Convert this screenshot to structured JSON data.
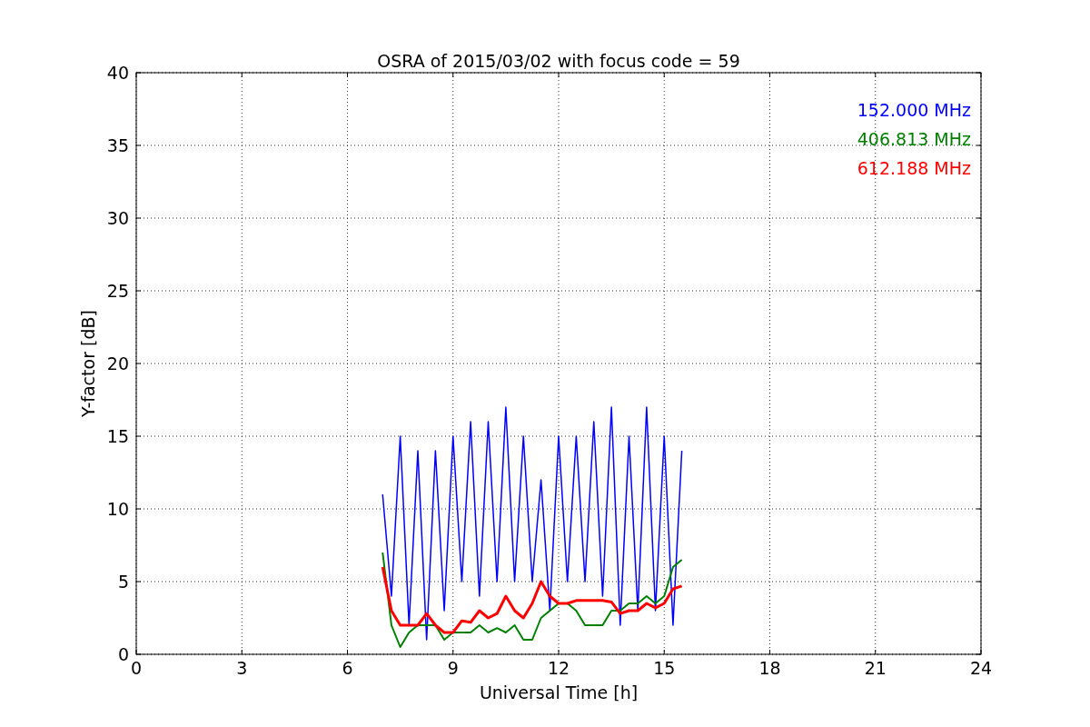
{
  "chart_data": {
    "type": "line",
    "title": "OSRA of 2015/03/02 with focus code = 59",
    "xlabel": "Universal Time [h]",
    "ylabel": "Y-factor [dB]",
    "x": [
      7.0,
      7.25,
      7.5,
      7.75,
      8.0,
      8.25,
      8.5,
      8.75,
      9.0,
      9.25,
      9.5,
      9.75,
      10.0,
      10.25,
      10.5,
      10.75,
      11.0,
      11.25,
      11.5,
      11.75,
      12.0,
      12.25,
      12.5,
      12.75,
      13.0,
      13.25,
      13.5,
      13.75,
      14.0,
      14.25,
      14.5,
      14.75,
      15.0,
      15.25,
      15.5
    ],
    "series": [
      {
        "name": "152.000 MHz",
        "color": "#0000ff",
        "values": [
          11,
          4,
          15,
          2,
          14,
          1,
          14,
          3,
          15,
          5,
          16,
          4,
          16,
          5,
          17,
          5,
          15,
          5,
          12,
          3,
          15,
          5,
          15,
          5,
          16,
          4,
          17,
          2,
          15,
          3,
          17,
          3,
          15,
          2,
          14
        ]
      },
      {
        "name": "406.813 MHz",
        "color": "#008000",
        "values": [
          7,
          2,
          0.5,
          1.5,
          2,
          2,
          2,
          1,
          1.5,
          1.5,
          1.5,
          2,
          1.5,
          1.8,
          1.5,
          2,
          1,
          1,
          2.5,
          3,
          3.5,
          3.5,
          3,
          2,
          2,
          2,
          3,
          3,
          3.5,
          3.5,
          4,
          3.5,
          4,
          6,
          6.5
        ]
      },
      {
        "name": "612.188 MHz",
        "color": "#ff0000",
        "values": [
          6,
          3,
          2,
          2,
          2,
          2.8,
          2,
          1.5,
          1.5,
          2.3,
          2.2,
          3,
          2.5,
          2.8,
          4,
          3,
          2.5,
          3.5,
          5,
          4,
          3.5,
          3.5,
          3.7,
          3.7,
          3.7,
          3.7,
          3.6,
          2.8,
          3,
          3,
          3.5,
          3.2,
          3.5,
          4.5,
          4.7
        ]
      }
    ],
    "grid": true,
    "xlim": [
      0,
      24
    ],
    "ylim": [
      0,
      40
    ],
    "xticks": [
      0,
      3,
      6,
      9,
      12,
      15,
      18,
      21,
      24
    ],
    "yticks": [
      0,
      5,
      10,
      15,
      20,
      25,
      30,
      35,
      40
    ]
  }
}
